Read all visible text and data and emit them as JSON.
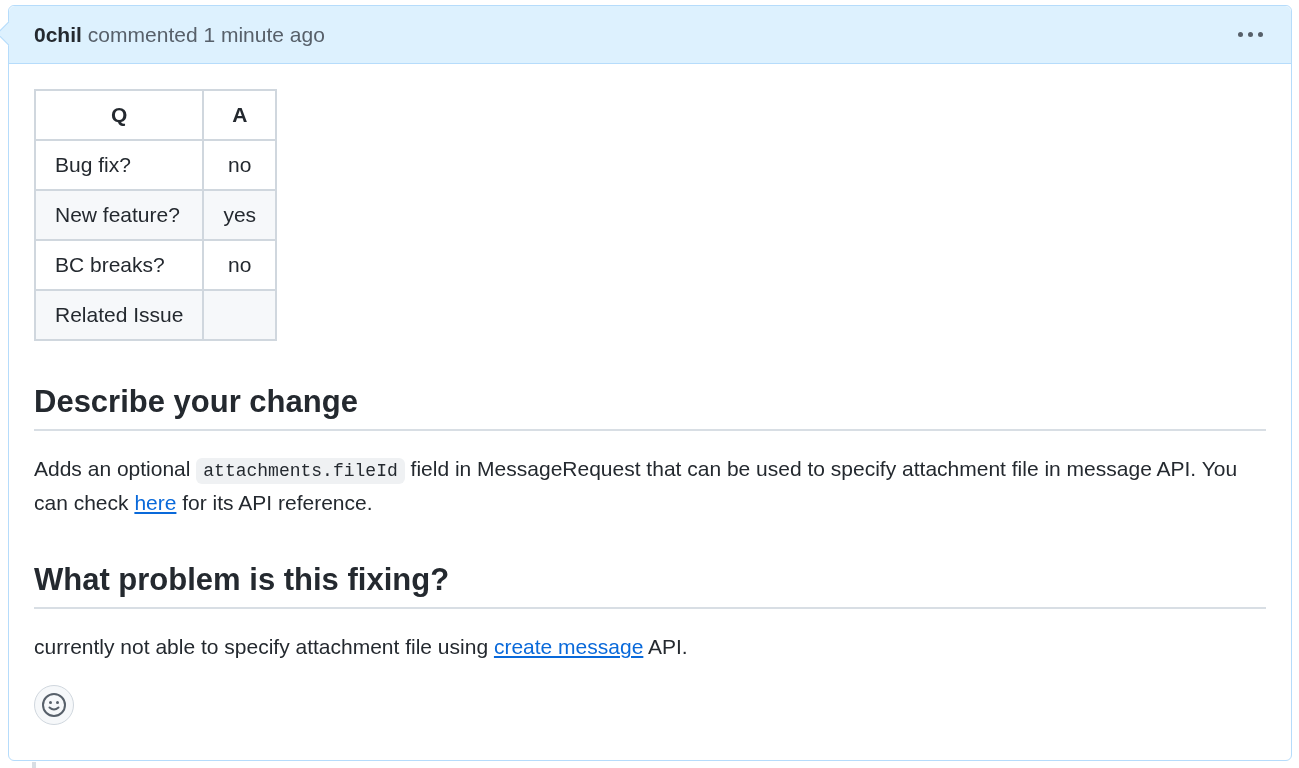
{
  "comment": {
    "author": "0chil",
    "action": "commented 1 minute ago"
  },
  "table": {
    "columns": [
      "Q",
      "A"
    ],
    "rows": [
      [
        "Bug fix?",
        "no"
      ],
      [
        "New feature?",
        "yes"
      ],
      [
        "BC breaks?",
        "no"
      ],
      [
        "Related Issue",
        ""
      ]
    ]
  },
  "sections": [
    {
      "heading": "Describe your change",
      "paragraph": [
        {
          "kind": "text",
          "text": "Adds an optional "
        },
        {
          "kind": "code",
          "text": "attachments.fileId"
        },
        {
          "kind": "text",
          "text": " field in MessageRequest that can be used to specify attachment file in message API. You can check "
        },
        {
          "kind": "link",
          "text": "here"
        },
        {
          "kind": "text",
          "text": " for its API reference."
        }
      ]
    },
    {
      "heading": "What problem is this fixing?",
      "paragraph": [
        {
          "kind": "text",
          "text": "currently not able to specify attachment file using "
        },
        {
          "kind": "link",
          "text": "create message"
        },
        {
          "kind": "text",
          "text": " API."
        }
      ]
    }
  ]
}
